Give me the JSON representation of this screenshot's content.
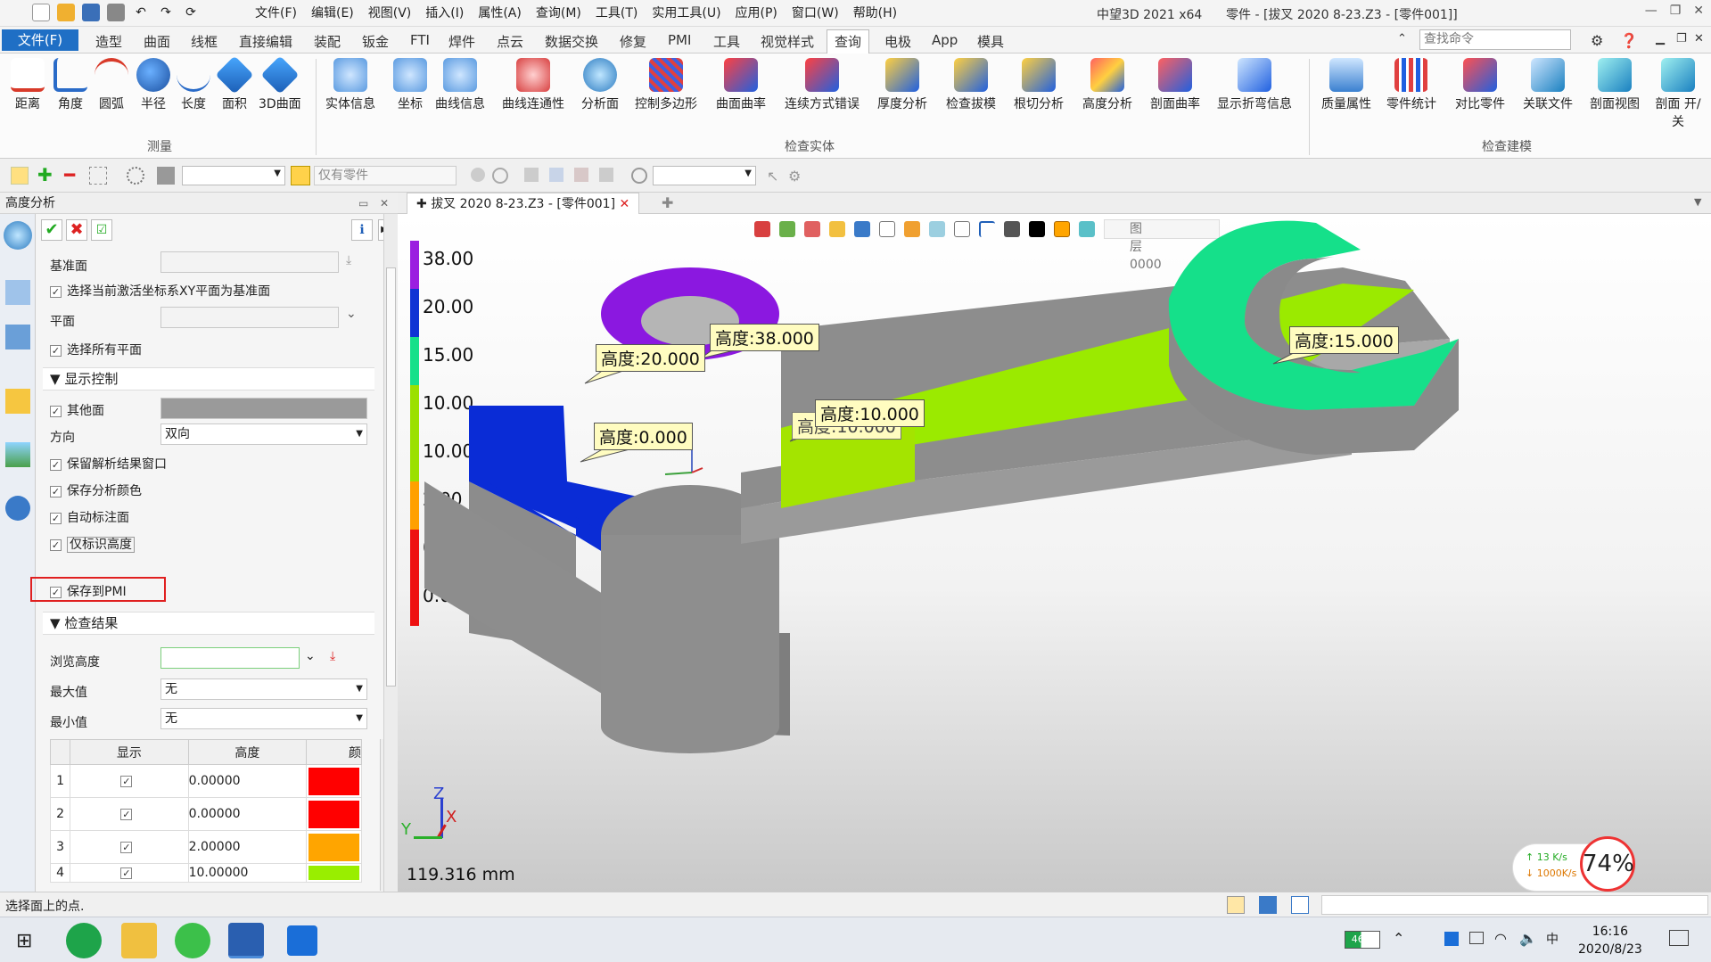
{
  "app": {
    "title": "中望3D 2021 x64",
    "document": "零件 - [拔叉  2020  8-23.Z3 - [零件001]]",
    "menu": [
      "文件(F)",
      "编辑(E)",
      "视图(V)",
      "插入(I)",
      "属性(A)",
      "查询(M)",
      "工具(T)",
      "实用工具(U)",
      "应用(P)",
      "窗口(W)",
      "帮助(H)"
    ]
  },
  "tabs": {
    "file": "文件(F)",
    "items": [
      "造型",
      "曲面",
      "线框",
      "直接编辑",
      "装配",
      "钣金",
      "FTI",
      "焊件",
      "点云",
      "数据交换",
      "修复",
      "PMI",
      "工具",
      "视觉样式",
      "查询",
      "电极",
      "App",
      "模具"
    ],
    "active": "查询",
    "search_placeholder": "查找命令"
  },
  "ribbon": {
    "group_measure": "测量",
    "group_inspect": "检查实体",
    "group_check_model": "检查建模",
    "measure": [
      "距离",
      "角度",
      "圆弧",
      "半径",
      "长度",
      "面积",
      "3D曲面"
    ],
    "inspect": [
      "实体信息",
      "坐标",
      "曲线信息",
      "曲线连通性",
      "分析面",
      "控制多边形",
      "曲面曲率",
      "连续方式错误",
      "厚度分析",
      "检查拔模",
      "根切分析",
      "高度分析",
      "剖面曲率",
      "显示折弯信息"
    ],
    "check": [
      "质量属性",
      "零件统计",
      "对比零件",
      "关联文件",
      "剖面视图",
      "剖面 开/关"
    ]
  },
  "toolbar": {
    "filter_label": "仅有零件"
  },
  "panel": {
    "title": "高度分析",
    "base_face_label": "基准面",
    "use_active_xy": "选择当前激活坐标系XY平面为基准面",
    "plane_label": "平面",
    "select_all_planes": "选择所有平面",
    "section_display": "显示控制",
    "other_faces": "其他面",
    "direction_label": "方向",
    "direction_value": "双向",
    "keep_window": "保留解析结果窗口",
    "keep_color": "保存分析颜色",
    "auto_label": "自动标注面",
    "only_height": "仅标识高度",
    "save_pmi": "保存到PMI",
    "section_results": "检查结果",
    "browse_height": "浏览高度",
    "max_label": "最大值",
    "max_value": "无",
    "min_label": "最小值",
    "min_value": "无",
    "table_headers": [
      "",
      "显示",
      "高度",
      "颜"
    ],
    "rows": [
      {
        "idx": "1",
        "height": "0.00000",
        "color": "#ff0000"
      },
      {
        "idx": "2",
        "height": "0.00000",
        "color": "#ff0000"
      },
      {
        "idx": "3",
        "height": "2.00000",
        "color": "#ffa500"
      },
      {
        "idx": "4",
        "height": "10.00000",
        "color": "#99ee00"
      }
    ]
  },
  "doc_tab": "拔叉  2020  8-23.Z3 - [零件001]",
  "viewport": {
    "layer": "图层0000",
    "legend": [
      {
        "label": "38.00",
        "color": "#9b1fe0"
      },
      {
        "label": "20.00",
        "color": "#1034d4"
      },
      {
        "label": "15.00",
        "color": "#16e08a"
      },
      {
        "label": "10.00",
        "color": "#9be000"
      },
      {
        "label": "10.00",
        "color": "#9be000"
      },
      {
        "label": "2.00",
        "color": "#ffa000"
      },
      {
        "label": "0.00",
        "color": "#ee1111"
      },
      {
        "label": "0.00",
        "color": "#ee1111"
      }
    ],
    "callouts": [
      "高度:38.000",
      "高度:20.000",
      "高度:0.000",
      "高度:10.000",
      "高度:15.000"
    ],
    "scale": "119.316 mm",
    "axis_z": "Z",
    "axis_x": "X",
    "axis_y": "Y"
  },
  "status": {
    "message": "选择面上的点."
  },
  "taskbar": {
    "time": "16:16",
    "date": "2020/8/23",
    "battery": "46%",
    "net_up": "13  K/s",
    "net_down": "1000K/s",
    "net_pct": "74%"
  }
}
